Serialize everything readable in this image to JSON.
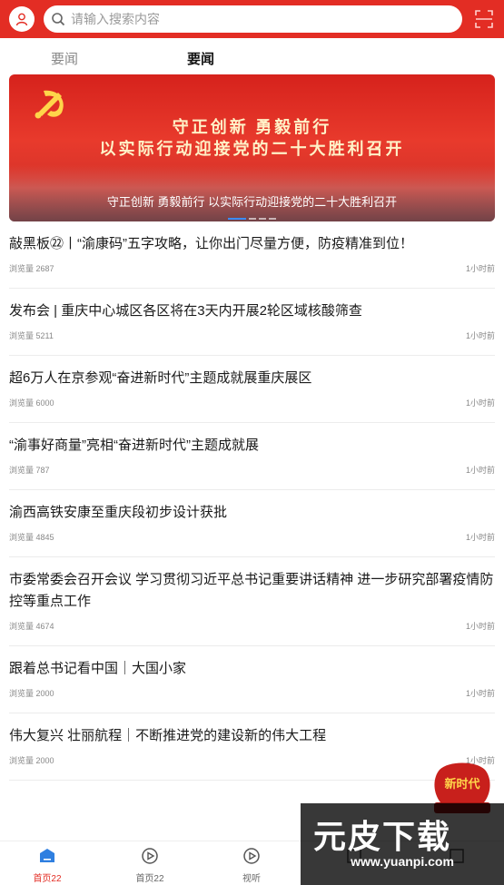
{
  "header": {
    "search_placeholder": "请输入搜索内容",
    "accent_color": "#e32d24"
  },
  "icons": {
    "avatar": "user-icon",
    "search": "search-icon",
    "scan": "scan-icon"
  },
  "tabs": [
    {
      "label": "要闻"
    },
    {
      "label": "要闻"
    }
  ],
  "banner": {
    "headline_line1": "守正创新  勇毅前行",
    "headline_line2": "以实际行动迎接党的二十大胜利召开",
    "caption": "守正创新 勇毅前行 以实际行动迎接党的二十大胜利召开"
  },
  "news": [
    {
      "title": "敲黑板㉒丨“渝康码”五字攻略，让你出门尽量方便，防疫精准到位！",
      "views": "浏览量 2687",
      "time": "1小时前"
    },
    {
      "title": "发布会 | 重庆中心城区各区将在3天内开展2轮区域核酸筛查",
      "views": "浏览量 5211",
      "time": "1小时前"
    },
    {
      "title": "超6万人在京参观“奋进新时代”主题成就展重庆展区",
      "views": "浏览量 6000",
      "time": "1小时前"
    },
    {
      "title": "“渝事好商量”亮相“奋进新时代”主题成就展",
      "views": "浏览量 787",
      "time": "1小时前"
    },
    {
      "title": "渝西高铁安康至重庆段初步设计获批",
      "views": "浏览量 4845",
      "time": "1小时前"
    },
    {
      "title": "市委常委会召开会议 学习贯彻习近平总书记重要讲话精神 进一步研究部署疫情防控等重点工作",
      "views": "浏览量 4674",
      "time": "1小时前"
    },
    {
      "title": "跟着总书记看中国｜大国小家",
      "views": "浏览量 2000",
      "time": "1小时前"
    },
    {
      "title": "伟大复兴 壮丽航程｜不断推进党的建设新的伟大工程",
      "views": "浏览量 2000",
      "time": "1小时前"
    }
  ],
  "floating_badge": {
    "text_main": "新时代"
  },
  "bottom_nav": [
    {
      "label": "首页22",
      "icon": "home-icon"
    },
    {
      "label": "首页22",
      "icon": "play-circle-icon"
    },
    {
      "label": "视听",
      "icon": "play-circle-icon"
    },
    {
      "label": "",
      "icon": "image-icon"
    },
    {
      "label": "",
      "icon": "image-icon"
    }
  ],
  "watermark": {
    "brand": "元皮下载",
    "url": "www.yuanpi.com"
  }
}
